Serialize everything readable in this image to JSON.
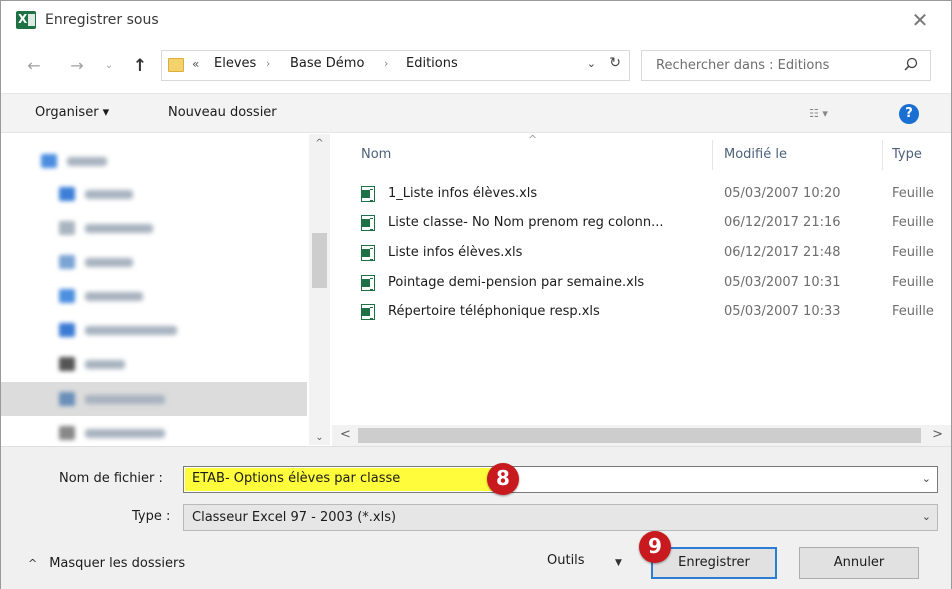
{
  "window": {
    "title": "Enregistrer sous",
    "close_glyph": "✕"
  },
  "nav": {
    "back_glyph": "←",
    "forward_glyph": "→",
    "recent_glyph": "⌄",
    "up_glyph": "↑",
    "breadcrumb_overflow": "«",
    "breadcrumbs": [
      "Eleves",
      "Base Démo",
      "Editions"
    ],
    "separator": "›",
    "dropdown_glyph": "⌄",
    "refresh_glyph": "↻",
    "search_placeholder": "Rechercher dans : Editions"
  },
  "toolbar": {
    "organize_label": "Organiser ▾",
    "new_folder_label": "Nouveau dossier",
    "view_glyph": "☷ ▾",
    "help_glyph": "?"
  },
  "filelist": {
    "sort_glyph": "^",
    "columns": {
      "name": "Nom",
      "modified": "Modifié le",
      "type": "Type"
    },
    "files": [
      {
        "name": "1_Liste infos élèves.xls",
        "modified": "05/03/2007 10:20",
        "type": "Feuille"
      },
      {
        "name": "Liste classe- No Nom prenom reg colonn...",
        "modified": "06/12/2017 21:16",
        "type": "Feuille"
      },
      {
        "name": "Liste infos élèves.xls",
        "modified": "06/12/2017 21:48",
        "type": "Feuille"
      },
      {
        "name": "Pointage demi-pension par semaine.xls",
        "modified": "05/03/2007 10:31",
        "type": "Feuille"
      },
      {
        "name": "Répertoire téléphonique resp.xls",
        "modified": "05/03/2007 10:33",
        "type": "Feuille"
      }
    ]
  },
  "scroll": {
    "up": "^",
    "down": "⌄",
    "left": "<",
    "right": ">"
  },
  "form": {
    "filename_label": "Nom de fichier :",
    "filename_value": "ETAB- Options élèves par classe",
    "type_label": "Type :",
    "type_value": "Classeur Excel 97 - 2003 (*.xls)",
    "chevron": "⌄"
  },
  "badges": {
    "step_8": "8",
    "step_9": "9"
  },
  "footer": {
    "hide_folders_caret": "^",
    "hide_folders_label": "Masquer les dossiers",
    "tools_label": "Outils",
    "tools_arrow": "▼",
    "save_label": "Enregistrer",
    "cancel_label": "Annuler"
  },
  "colors": {
    "highlight": "#fefc3b",
    "badge": "#c8191e",
    "excel_green": "#1e7145",
    "help_blue": "#1a6fd3"
  }
}
